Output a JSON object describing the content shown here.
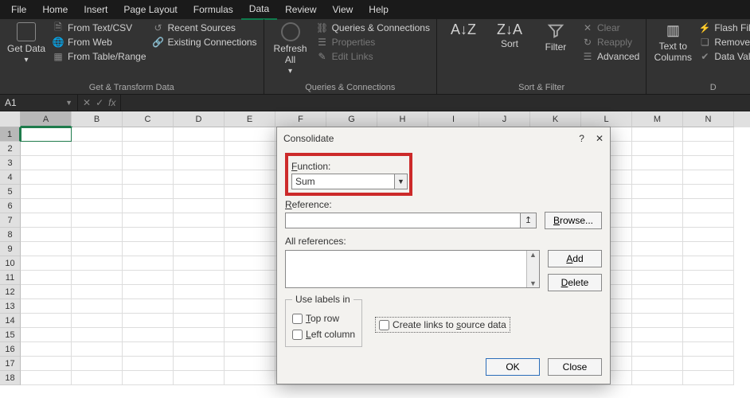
{
  "menubar": {
    "items": [
      "File",
      "Home",
      "Insert",
      "Page Layout",
      "Formulas",
      "Data",
      "Review",
      "View",
      "Help"
    ],
    "active": "Data"
  },
  "ribbon": {
    "group1": {
      "title": "Get & Transform Data",
      "get_data": "Get Data",
      "from_text_csv": "From Text/CSV",
      "from_web": "From Web",
      "from_table_range": "From Table/Range",
      "recent_sources": "Recent Sources",
      "existing_connections": "Existing Connections"
    },
    "group2": {
      "title": "Queries & Connections",
      "refresh_all": "Refresh All",
      "queries_connections": "Queries & Connections",
      "properties": "Properties",
      "edit_links": "Edit Links"
    },
    "group3": {
      "title": "Sort & Filter",
      "sort": "Sort",
      "filter": "Filter",
      "clear": "Clear",
      "reapply": "Reapply",
      "advanced": "Advanced"
    },
    "group4": {
      "title": "D",
      "text_to_columns": "Text to Columns",
      "flash_fill": "Flash Fill",
      "remove_dup": "Remove Dup",
      "data_validation": "Data Validatio"
    }
  },
  "namebox": "A1",
  "columns": [
    "A",
    "B",
    "C",
    "D",
    "E",
    "F",
    "G",
    "H",
    "I",
    "J",
    "K",
    "L",
    "M",
    "N"
  ],
  "row_count": 18,
  "active_cell": "A1",
  "dialog": {
    "title": "Consolidate",
    "function_label": "Function:",
    "function_value": "Sum",
    "reference_label": "Reference:",
    "browse": "Browse...",
    "all_references": "All references:",
    "add": "Add",
    "delete": "Delete",
    "use_labels_in": "Use labels in",
    "top_row": "Top row",
    "left_column": "Left column",
    "create_links": "Create links to source data",
    "ok": "OK",
    "close": "Close"
  }
}
